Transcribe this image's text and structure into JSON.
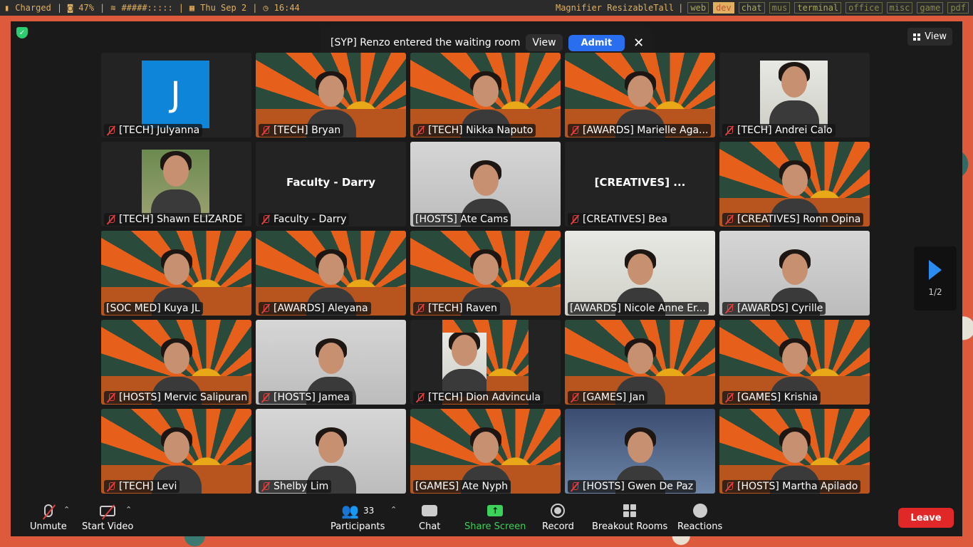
{
  "statusbar": {
    "battery": "Charged",
    "cpu": "47%",
    "wifi": "#####:::::",
    "date": "Thu Sep  2",
    "time": "16:44",
    "window_title": "Magnifier ResizableTall",
    "workspaces": [
      "web",
      "dev",
      "chat",
      "mus",
      "terminal",
      "office",
      "misc",
      "game",
      "pdf"
    ],
    "active_workspace": "dev"
  },
  "notification": {
    "text": "[SYP] Renzo entered the waiting room",
    "view_label": "View",
    "admit_label": "Admit"
  },
  "view_button": "View",
  "pager": "1/2",
  "participants": [
    {
      "name": "[TECH] Julyanna",
      "muted": true,
      "kind": "avatar",
      "initial": "J"
    },
    {
      "name": "[TECH] Bryan",
      "muted": true,
      "kind": "sun"
    },
    {
      "name": "[TECH] Nikka Naputo",
      "muted": true,
      "kind": "sun"
    },
    {
      "name": "[AWARDS] Marielle Aga...",
      "muted": true,
      "kind": "sun"
    },
    {
      "name": "[TECH] Andrei Calo",
      "muted": true,
      "kind": "inset-room"
    },
    {
      "name": "[TECH] Shawn ELIZARDE",
      "muted": true,
      "kind": "inset-green"
    },
    {
      "name": "Faculty - Darry",
      "muted": true,
      "kind": "name",
      "display": "Faculty - Darry"
    },
    {
      "name": "[HOSTS] Ate Cams",
      "muted": false,
      "kind": "gray"
    },
    {
      "name": "[CREATIVES] Bea",
      "muted": true,
      "kind": "name",
      "display": "[CREATIVES] ..."
    },
    {
      "name": "[CREATIVES] Ronn Opina",
      "muted": true,
      "kind": "sun"
    },
    {
      "name": "[SOC MED] Kuya JL",
      "muted": false,
      "kind": "sun",
      "active": true
    },
    {
      "name": "[AWARDS] Aleyana",
      "muted": true,
      "kind": "sun"
    },
    {
      "name": "[TECH] Raven",
      "muted": true,
      "kind": "sun"
    },
    {
      "name": "[AWARDS] Nicole Anne Er...",
      "muted": false,
      "kind": "room"
    },
    {
      "name": "[AWARDS] Cyrille",
      "muted": true,
      "kind": "gray"
    },
    {
      "name": "[HOSTS] Mervic Salipuran",
      "muted": true,
      "kind": "sun"
    },
    {
      "name": "[HOSTS] Jamea",
      "muted": true,
      "kind": "gray"
    },
    {
      "name": "[TECH] Dion Advincula",
      "muted": true,
      "kind": "inset-sun"
    },
    {
      "name": "[GAMES] Jan",
      "muted": true,
      "kind": "sun"
    },
    {
      "name": "[GAMES] Krishia",
      "muted": true,
      "kind": "sun"
    },
    {
      "name": "[TECH] Levi",
      "muted": true,
      "kind": "sun"
    },
    {
      "name": "Shelby Lim",
      "muted": true,
      "kind": "gray"
    },
    {
      "name": "[GAMES] Ate Nyph",
      "muted": false,
      "kind": "sun"
    },
    {
      "name": "[HOSTS] Gwen De Paz",
      "muted": true,
      "kind": "blue"
    },
    {
      "name": "[HOSTS] Martha Apilado",
      "muted": true,
      "kind": "sun"
    }
  ],
  "toolbar": {
    "unmute": "Unmute",
    "start_video": "Start Video",
    "participants": "Participants",
    "participants_count": "33",
    "chat": "Chat",
    "share": "Share Screen",
    "record": "Record",
    "breakout": "Breakout Rooms",
    "reactions": "Reactions",
    "leave": "Leave"
  },
  "colors": {
    "share_green": "#3bd15a",
    "admit_blue": "#2a6ef0",
    "leave_red": "#e02828",
    "active_speaker": "#3bd15a"
  }
}
